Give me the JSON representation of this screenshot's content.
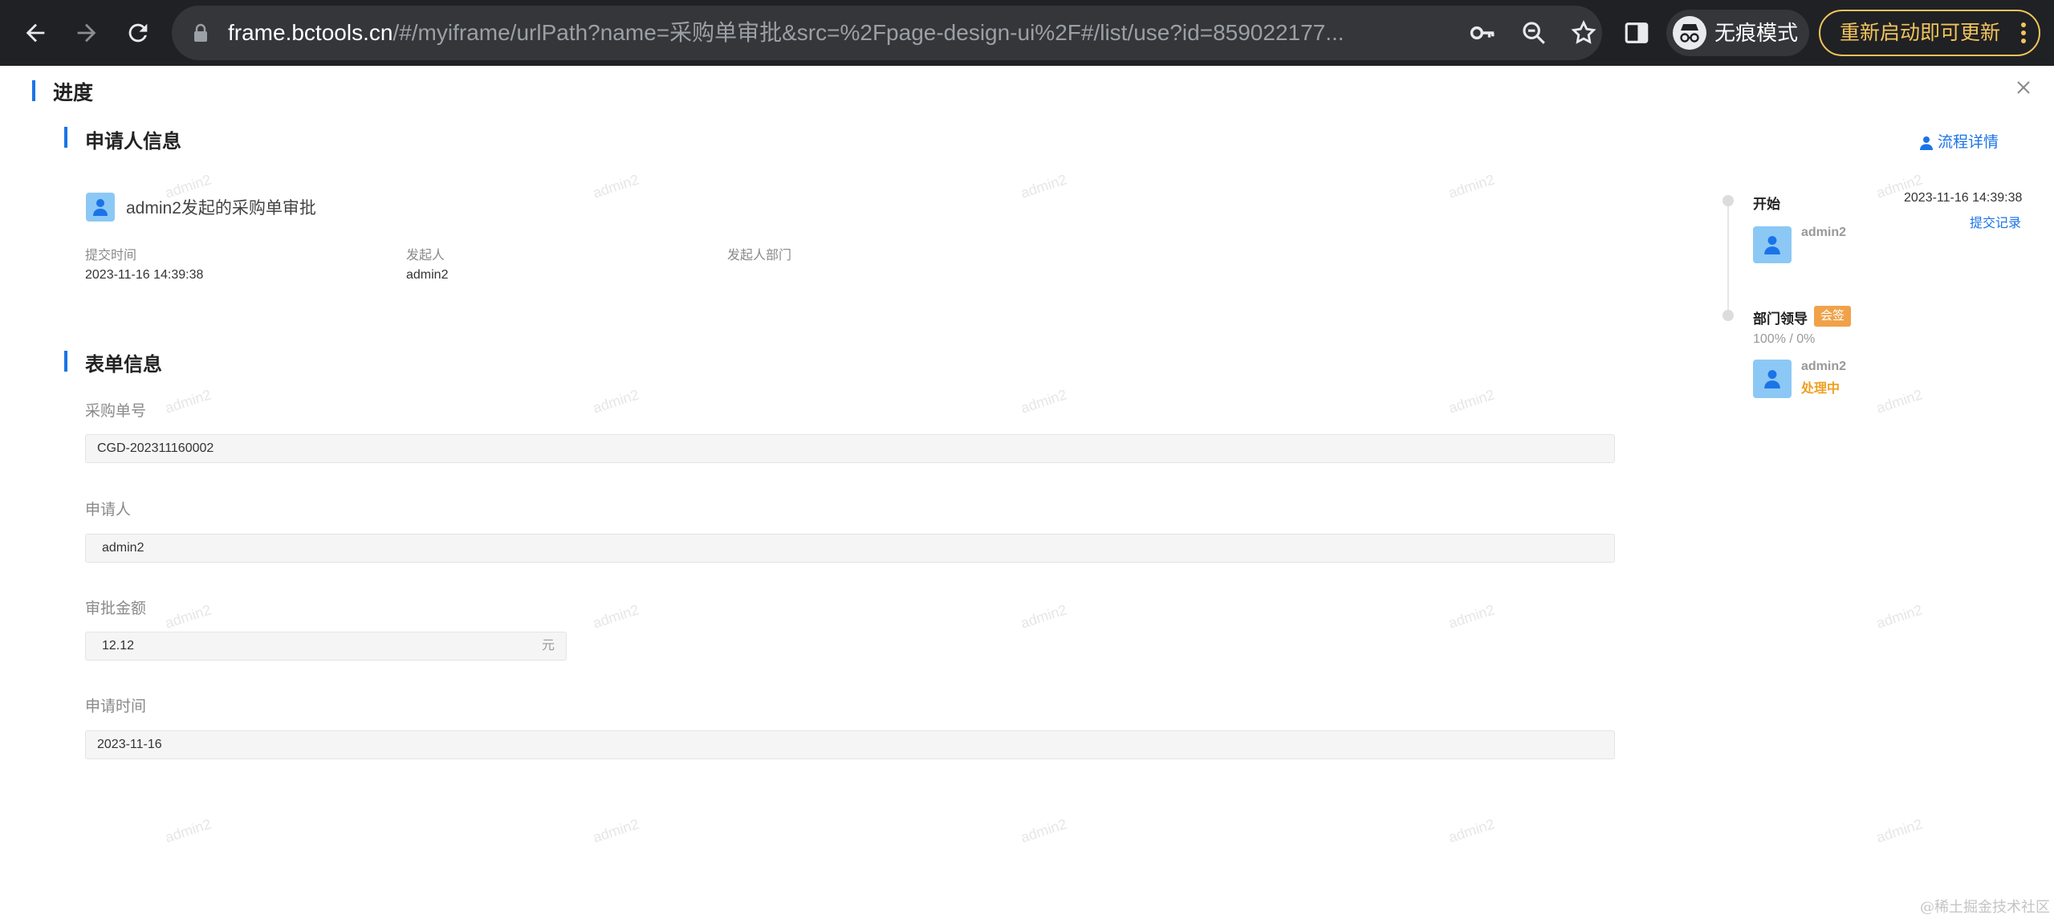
{
  "browser": {
    "url_host": "frame.bctools.cn",
    "url_path": "/#/myiframe/urlPath?name=采购单审批&src=%2Fpage-design-ui%2F#/list/use?id=859022177...",
    "incognito_label": "无痕模式",
    "update_label": "重新启动即可更新"
  },
  "page": {
    "title": "进度",
    "watermark_text": "admin2",
    "corner_watermark": "@稀土掘金技术社区"
  },
  "applicant_info": {
    "section_title": "申请人信息",
    "launch_title": "admin2发起的采购单审批",
    "fields": [
      {
        "label": "提交时间",
        "value": "2023-11-16 14:39:38"
      },
      {
        "label": "发起人",
        "value": "admin2"
      },
      {
        "label": "发起人部门",
        "value": ""
      }
    ]
  },
  "form_info": {
    "section_title": "表单信息",
    "fields": [
      {
        "label": "采购单号",
        "value": "CGD-202311160002"
      },
      {
        "label": "申请人",
        "value": "admin2"
      },
      {
        "label": "审批金额",
        "value": "12.12",
        "suffix": "元"
      },
      {
        "label": "申请时间",
        "value": "2023-11-16"
      }
    ]
  },
  "timeline": {
    "flow_detail_label": "流程详情",
    "nodes": [
      {
        "title": "开始",
        "time": "2023-11-16 14:39:38",
        "action": "提交记录",
        "user": "admin2"
      },
      {
        "title": "部门领导",
        "badge": "会签",
        "progress": "100% / 0%",
        "user": "admin2",
        "status": "处理中"
      }
    ]
  },
  "colors": {
    "accent": "#1a73e8",
    "warning": "#f0a24a",
    "avatar_bg": "#8cc8f5",
    "chrome_bg": "#202124",
    "update_border": "#f2c55c"
  }
}
